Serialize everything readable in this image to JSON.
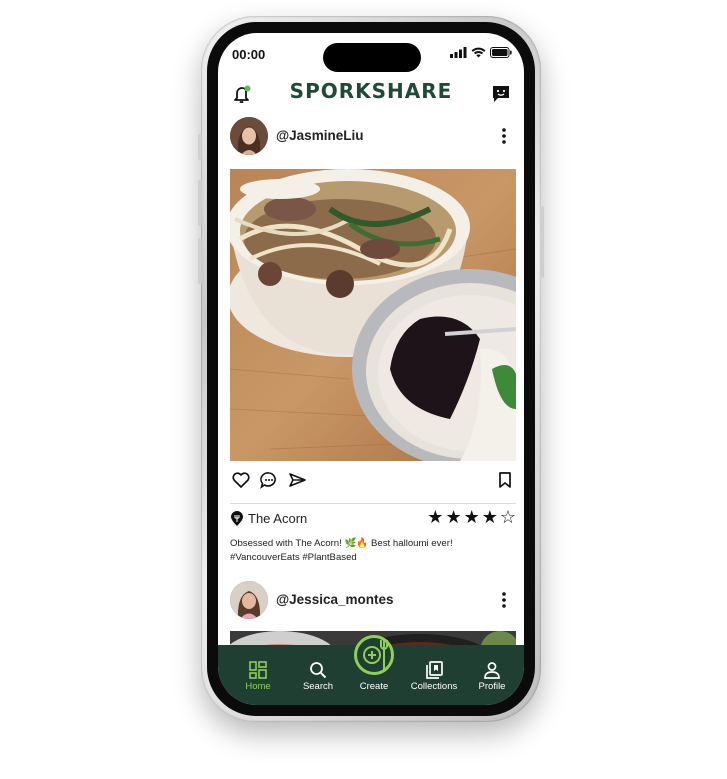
{
  "status_bar": {
    "time": "00:00"
  },
  "app": {
    "title": "SPORKSHARE"
  },
  "header": {
    "left_icon": "bell-notification-icon",
    "right_icon": "chat-bubble-icon"
  },
  "posts": [
    {
      "username": "@JasmineLiu",
      "restaurant": "The Acorn",
      "rating": 4,
      "rating_max": 5,
      "caption_line1": "Obsessed with The Acorn! 🌿🔥 Best halloumi ever!",
      "caption_line2": "#VancouverEats #PlantBased"
    },
    {
      "username": "@Jessica_montes"
    }
  ],
  "nav": {
    "items": [
      {
        "label": "Home",
        "icon": "home-grid-icon",
        "active": true
      },
      {
        "label": "Search",
        "icon": "search-icon",
        "active": false
      },
      {
        "label": "Create",
        "icon": "create-plus-fork-icon",
        "active": false
      },
      {
        "label": "Collections",
        "icon": "collections-icon",
        "active": false
      },
      {
        "label": "Profile",
        "icon": "profile-icon",
        "active": false
      }
    ]
  },
  "colors": {
    "brand_green": "#1f4a38",
    "nav_background": "#1f3f33",
    "accent_green": "#8fcf55"
  }
}
